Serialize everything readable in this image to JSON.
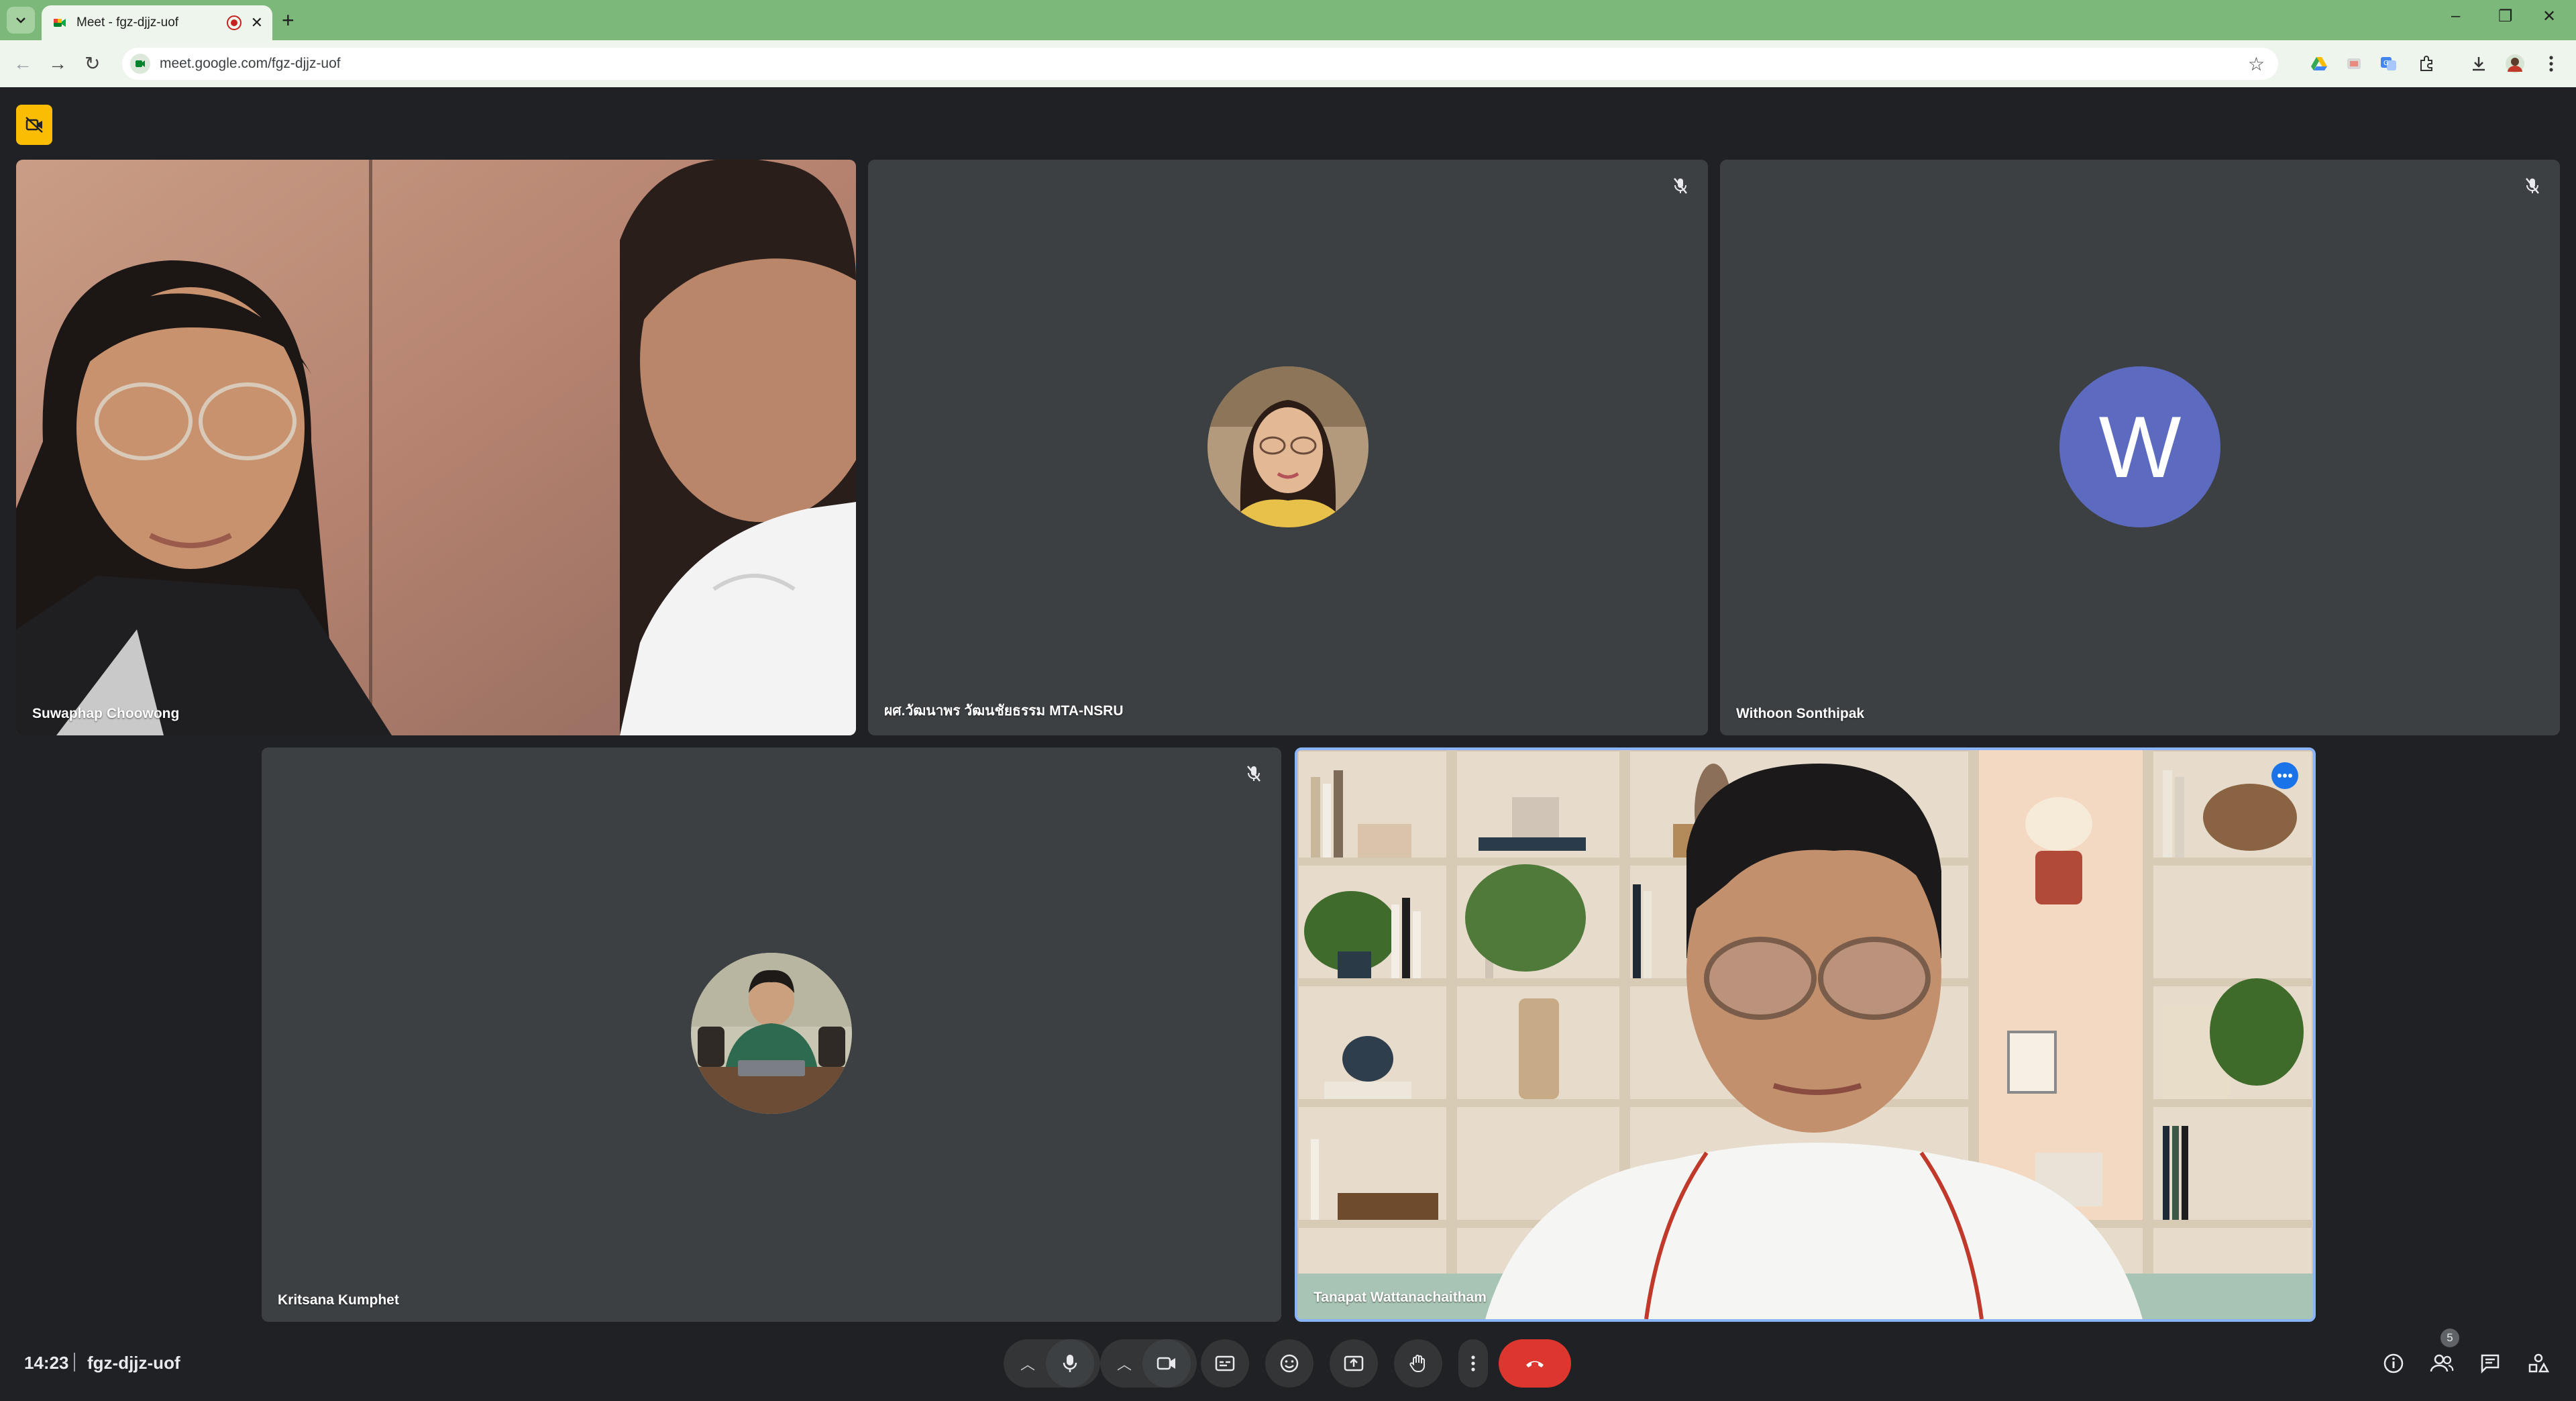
{
  "browser": {
    "tab_title": "Meet - fgz-djjz-uof",
    "tab_close": "✕",
    "new_tab": "+",
    "url": "meet.google.com/fgz-djjz-uof",
    "window_controls": [
      "–",
      "❐",
      "✕"
    ]
  },
  "meeting": {
    "participants": [
      {
        "name": "Suwaphap Choowong",
        "video": "camera-on",
        "muted": false
      },
      {
        "name": "ผศ.วัฒนาพร วัฒนชัยธรรม MTA-NSRU",
        "video": "profile-photo",
        "muted": true
      },
      {
        "name": "Withoon Sonthipak",
        "video": "initial-avatar",
        "initial": "W",
        "avatar_color": "#5c6bc0",
        "muted": true
      },
      {
        "name": "Kritsana Kumphet",
        "video": "profile-photo",
        "muted": true
      },
      {
        "name": "Tanapat Wattanachaitham",
        "video": "camera-on",
        "muted": false,
        "speaking": true
      }
    ]
  },
  "bottombar": {
    "time": "14:23",
    "meeting_code": "fgz-djjz-uof",
    "participant_count": "5",
    "controls": [
      "mic-options",
      "mic",
      "camera-options",
      "camera",
      "captions",
      "reactions",
      "present",
      "raise-hand",
      "more-options",
      "leave-call"
    ],
    "right_icons": [
      "info-icon",
      "people-icon",
      "chat-icon",
      "activities-icon"
    ],
    "hangup_color": "#dc362e"
  }
}
